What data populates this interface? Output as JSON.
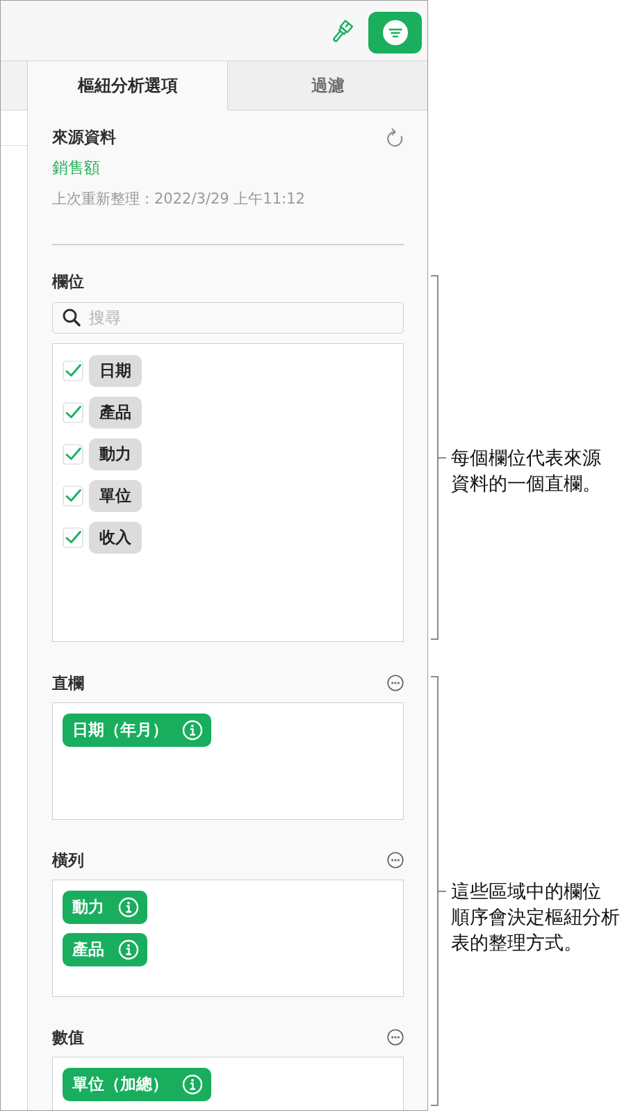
{
  "toolbar": [
    {
      "kind": "format",
      "selected": false
    },
    {
      "kind": "organize",
      "selected": true
    }
  ],
  "tabs": [
    {
      "label": "樞紐分析選項",
      "selected": true
    },
    {
      "label": "過濾",
      "selected": false
    }
  ],
  "source": {
    "title": "來源資料",
    "name": "銷售額",
    "refreshed": "上次重新整理：2022/3/29 上午11:12"
  },
  "fields": {
    "title": "欄位",
    "search": {
      "placeholder": "搜尋"
    },
    "items": [
      {
        "label": "日期",
        "checked": true
      },
      {
        "label": "產品",
        "checked": true
      },
      {
        "label": "動力",
        "checked": true
      },
      {
        "label": "單位",
        "checked": true
      },
      {
        "label": "收入",
        "checked": true
      }
    ]
  },
  "sections": [
    {
      "title": "直欄",
      "chips": [
        "日期（年月）"
      ]
    },
    {
      "title": "橫列",
      "chips": [
        "動力",
        "產品"
      ]
    },
    {
      "title": "數值",
      "chips": [
        "單位（加總）"
      ]
    }
  ],
  "callouts": [
    "每個欄位代表來源資料的一個直欄。",
    "這些區域中的欄位順序會決定樞紐分析表的整理方式。"
  ]
}
